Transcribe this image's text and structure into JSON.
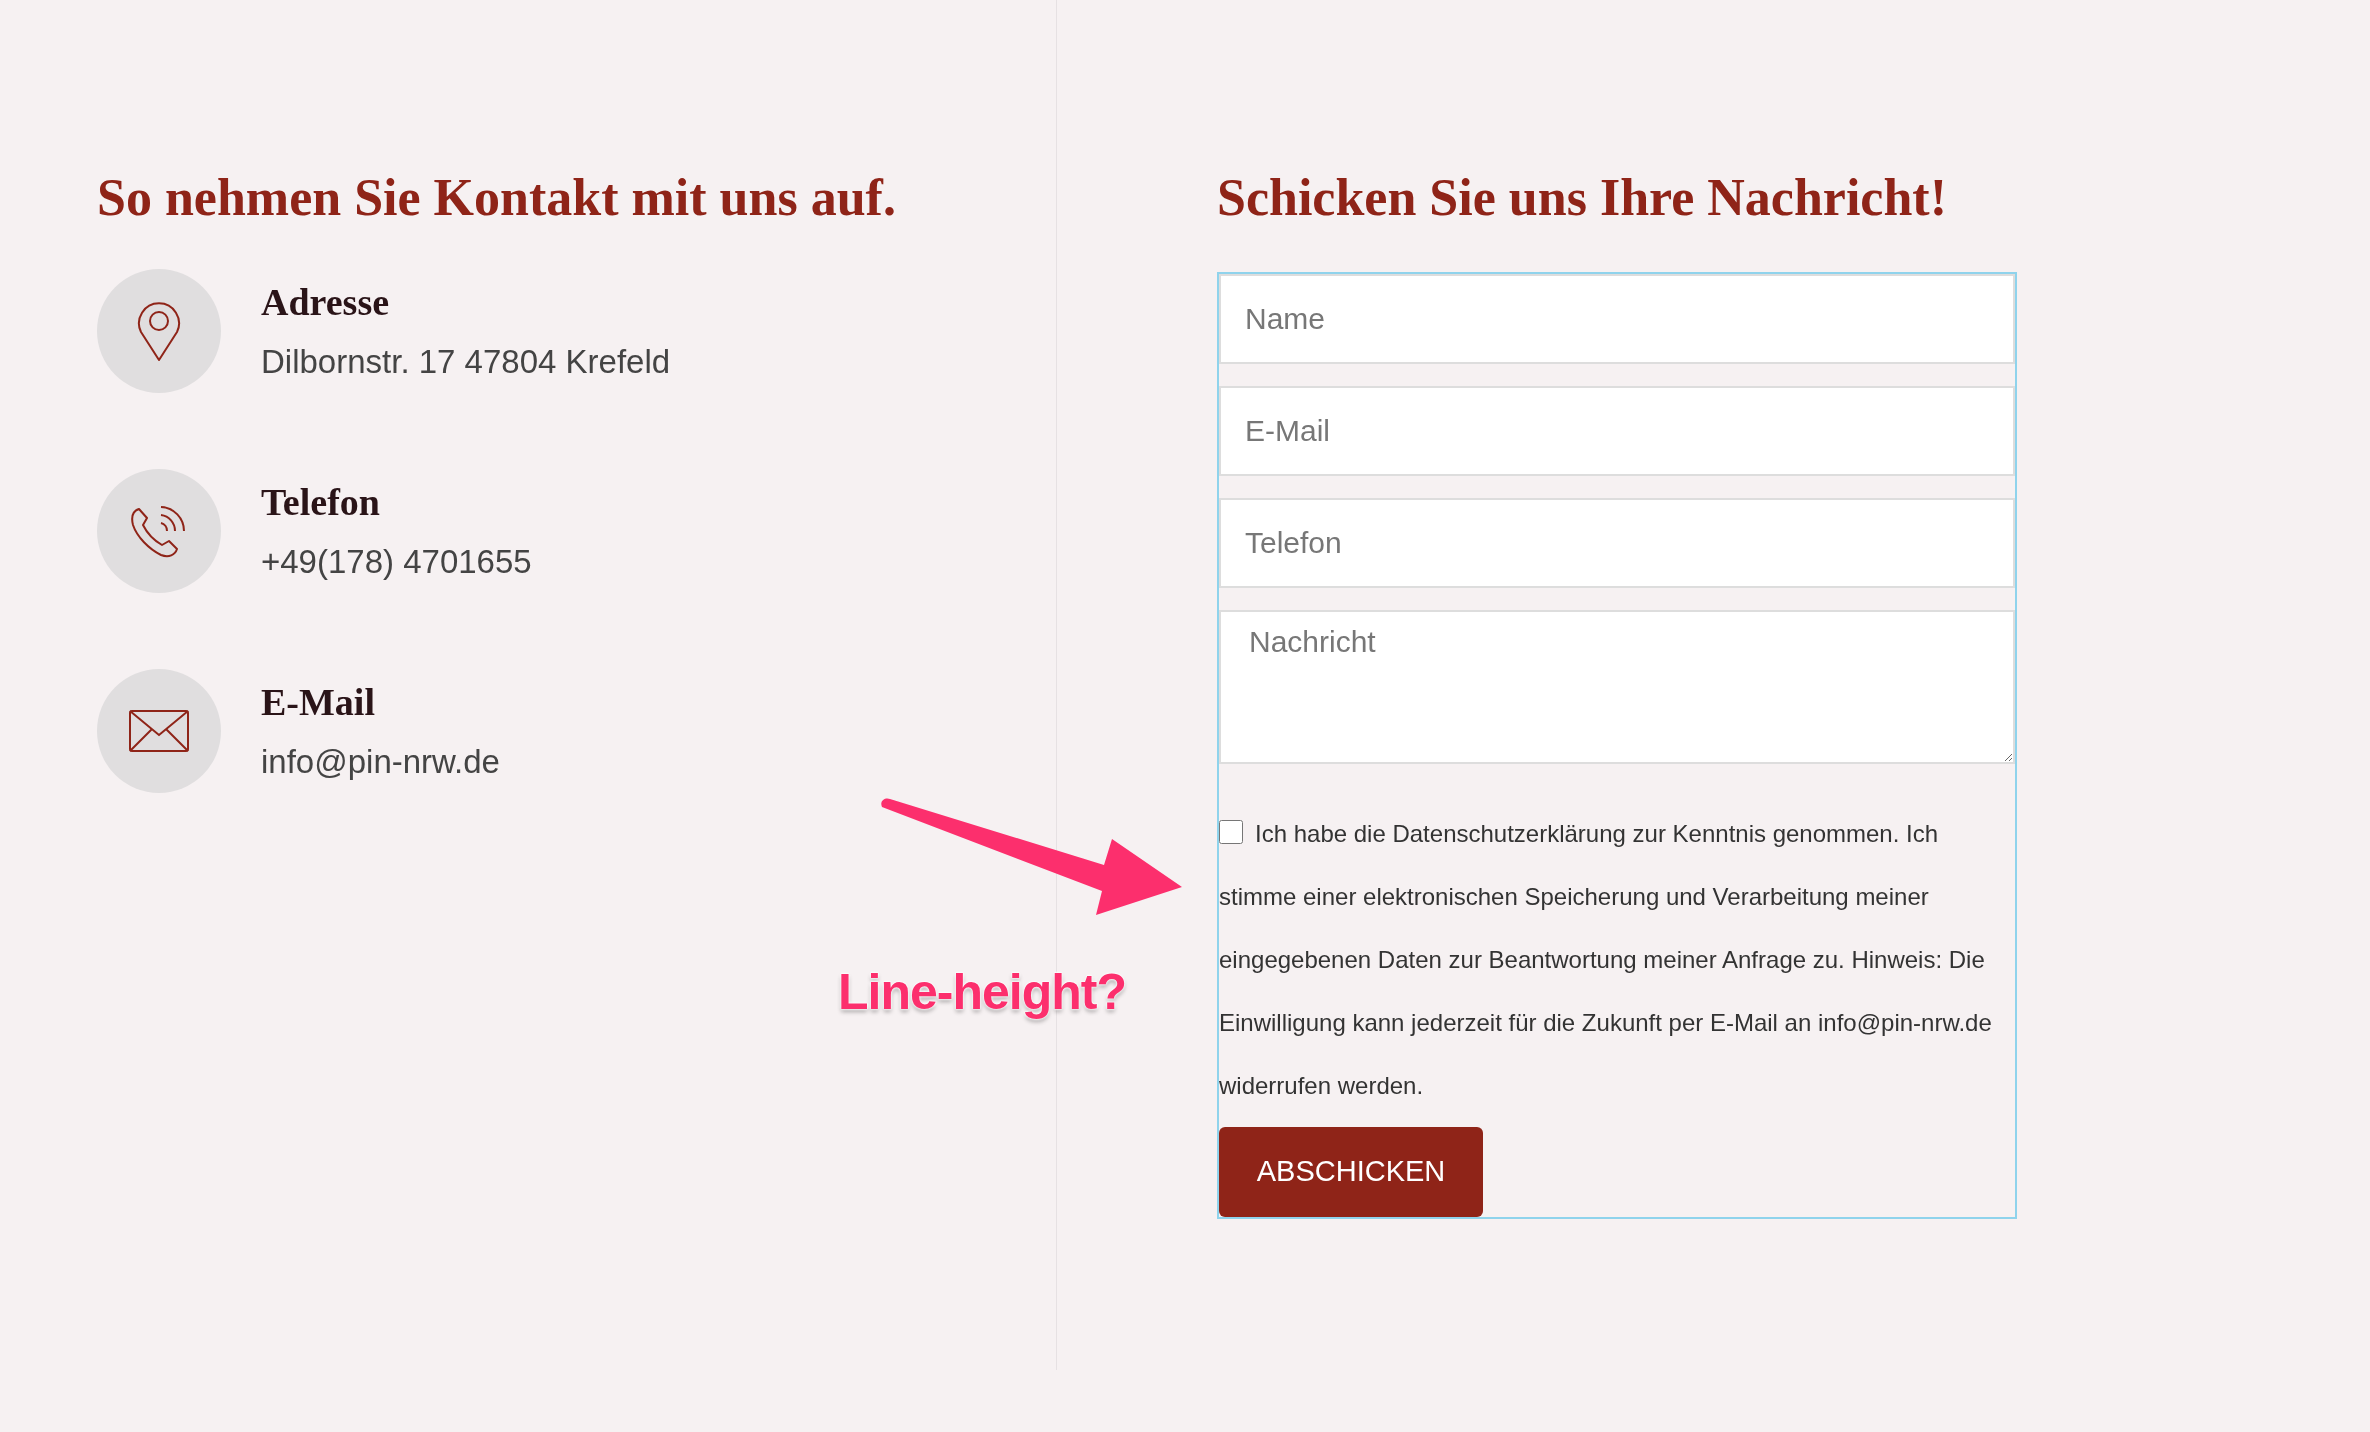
{
  "contact": {
    "heading": "So nehmen Sie Kontakt mit uns auf.",
    "items": [
      {
        "kind": "pin",
        "title": "Adresse",
        "text": "Dilbornstr. 17 47804 Krefeld"
      },
      {
        "kind": "phone",
        "title": "Telefon",
        "text": "+49(178) 4701655"
      },
      {
        "kind": "mail",
        "title": "E-Mail",
        "text": "info@pin-nrw.de"
      }
    ]
  },
  "form": {
    "heading": "Schicken Sie uns Ihre Nachricht!",
    "fields": [
      {
        "kind": "input",
        "placeholder": "Name"
      },
      {
        "kind": "input",
        "placeholder": "E-Mail"
      },
      {
        "kind": "input",
        "placeholder": "Telefon"
      },
      {
        "kind": "textarea",
        "placeholder": "Nachricht"
      }
    ],
    "consent": {
      "checked": false,
      "text": "Ich habe die Datenschutzerklärung zur Kenntnis genommen. Ich stimme einer elektronischen Speicherung und Verarbeitung meiner eingegebenen Daten zur Beantwortung meiner Anfrage zu. Hinweis: Die Einwilligung kann jederzeit für die Zukunft per E-Mail an info@pin-nrw.de widerrufen werden."
    },
    "submit": "ABSCHICKEN"
  },
  "annotation": {
    "text": "Line-height?"
  }
}
